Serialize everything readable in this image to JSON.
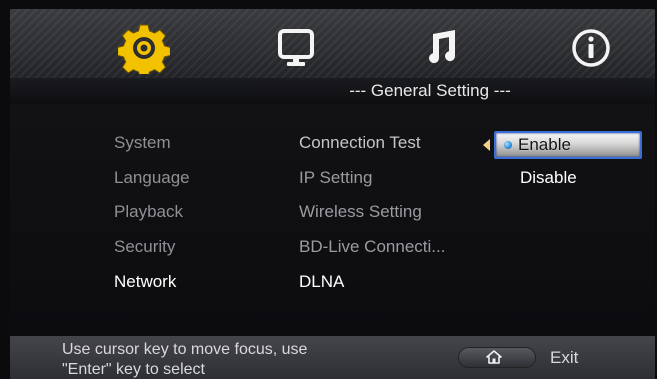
{
  "header": {
    "tabs": [
      {
        "icon": "gear-icon",
        "selected": true
      },
      {
        "icon": "monitor-icon",
        "selected": false
      },
      {
        "icon": "music-note-icon",
        "selected": false
      },
      {
        "icon": "info-icon",
        "selected": false
      }
    ],
    "title": "--- General Setting ---"
  },
  "menu": {
    "items": [
      {
        "label": "System",
        "active": false
      },
      {
        "label": "Language",
        "active": false
      },
      {
        "label": "Playback",
        "active": false
      },
      {
        "label": "Security",
        "active": false
      },
      {
        "label": "Network",
        "active": true
      }
    ]
  },
  "submenu": {
    "items": [
      {
        "label": "Connection Test"
      },
      {
        "label": "IP Setting"
      },
      {
        "label": "Wireless Setting"
      },
      {
        "label": "BD-Live Connecti..."
      },
      {
        "label": "DLNA"
      }
    ]
  },
  "options": {
    "items": [
      {
        "label": "Enable",
        "selected": true
      },
      {
        "label": "Disable",
        "selected": false
      }
    ]
  },
  "footer": {
    "help_line1": "Use cursor key to move focus, use",
    "help_line2": "\"Enter\" key to select",
    "exit_label": "Exit",
    "exit_icon": "home-icon"
  },
  "colors": {
    "accent_gear": "#f2c200",
    "focus_border": "#3b6fd6"
  }
}
